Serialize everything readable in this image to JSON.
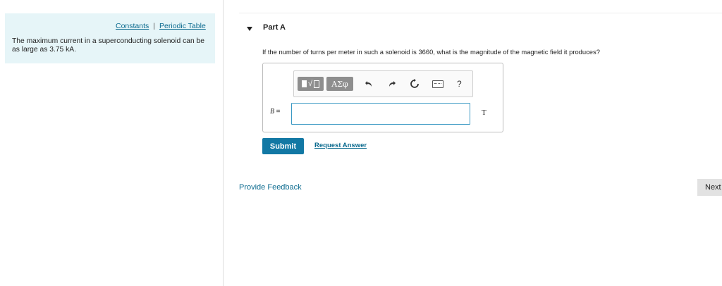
{
  "sidebar": {
    "constants_link": "Constants",
    "separator": "|",
    "periodic_table_link": "Periodic Table",
    "problem_text": "The maximum current in a superconducting solenoid can be as large as 3.75 kA."
  },
  "part": {
    "title": "Part A",
    "question": "If the number of turns per meter in such a solenoid is 3660, what is the magnitude of the magnetic field it produces?"
  },
  "toolbar": {
    "greek_label": "ΑΣφ",
    "undo_icon": "undo-arrow",
    "redo_icon": "redo-arrow",
    "reset_icon": "reset-circle",
    "keyboard_icon": "keyboard",
    "help_label": "?"
  },
  "answer": {
    "variable": "B",
    "equals": "=",
    "value": "",
    "unit": "T"
  },
  "actions": {
    "submit_label": "Submit",
    "request_answer_label": "Request Answer",
    "feedback_label": "Provide Feedback",
    "next_label": "Next"
  },
  "colors": {
    "info_bg": "#e6f5f8",
    "link": "#0c6b8f",
    "submit_bg": "#1278a4",
    "toolbar_btn": "#8e8e8e"
  }
}
